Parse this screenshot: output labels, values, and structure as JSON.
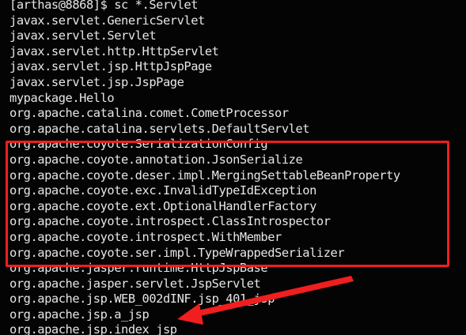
{
  "terminal": {
    "prompt": "[arthas@8868]$ sc *.Servlet",
    "output": [
      "javax.servlet.GenericServlet",
      "javax.servlet.Servlet",
      "javax.servlet.http.HttpServlet",
      "javax.servlet.jsp.HttpJspPage",
      "javax.servlet.jsp.JspPage",
      "mypackage.Hello",
      "org.apache.catalina.comet.CometProcessor",
      "org.apache.catalina.servlets.DefaultServlet",
      "org.apache.coyote.SerializationConfig",
      "org.apache.coyote.annotation.JsonSerialize",
      "org.apache.coyote.deser.impl.MergingSettableBeanProperty",
      "org.apache.coyote.exc.InvalidTypeIdException",
      "org.apache.coyote.ext.OptionalHandlerFactory",
      "org.apache.coyote.introspect.ClassIntrospector",
      "org.apache.coyote.introspect.WithMember",
      "org.apache.coyote.ser.impl.TypeWrappedSerializer",
      "org.apache.jasper.runtime.HttpJspBase",
      "org.apache.jasper.servlet.JspServlet",
      "org.apache.jsp.WEB_002dINF.jsp_401_jsp",
      "org.apache.jsp.a_jsp",
      "org.apache.jsp.index_jsp"
    ]
  },
  "annotations": {
    "highlight_color": "#f01e1e",
    "arrow_color": "#f01e1e"
  }
}
